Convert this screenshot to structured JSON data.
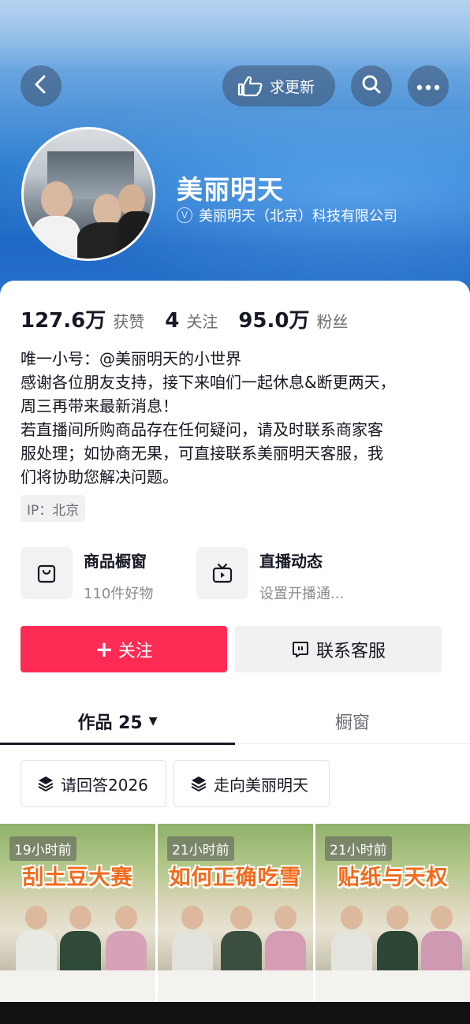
{
  "header": {
    "update_label": "求更新",
    "name": "美丽明天",
    "verified_text": "美丽明天（北京）科技有限公司"
  },
  "stats": [
    {
      "num": "127.6万",
      "label": "获赞"
    },
    {
      "num": "4",
      "label": "关注"
    },
    {
      "num": "95.0万",
      "label": "粉丝"
    }
  ],
  "bio": [
    "唯一小号：@美丽明天的小世界",
    "感谢各位朋友支持，接下来咱们一起休息&断更两天，",
    "周三再带来最新消息！",
    "若直播间所购商品存在任何疑问，请及时联系商家客",
    "服处理；如协商无果，可直接联系美丽明天客服，我",
    "们将协助您解决问题。"
  ],
  "ip": "IP：北京",
  "features": {
    "shop": {
      "title": "商品橱窗",
      "sub": "110件好物"
    },
    "live": {
      "title": "直播动态",
      "sub": "设置开播通..."
    }
  },
  "actions": {
    "follow": "关注",
    "contact": "联系客服"
  },
  "tabs": {
    "works": "作品 25",
    "shop": "橱窗"
  },
  "collections": [
    "请回答2026",
    "走向美丽明天"
  ],
  "videos": [
    {
      "time": "19小时前",
      "title": "刮土豆大赛"
    },
    {
      "time": "21小时前",
      "title": "如何正确吃雪"
    },
    {
      "time": "21小时前",
      "title": "贴纸与天权"
    }
  ],
  "colors": {
    "accent": "#fe2c55",
    "banner": "#2f7fd0"
  },
  "icons": [
    "back-icon",
    "hand-point-icon",
    "search-icon",
    "more-icon",
    "verified-icon",
    "bag-icon",
    "tv-icon",
    "plus-icon",
    "chat-icon",
    "layers-icon",
    "caret-down-icon"
  ]
}
